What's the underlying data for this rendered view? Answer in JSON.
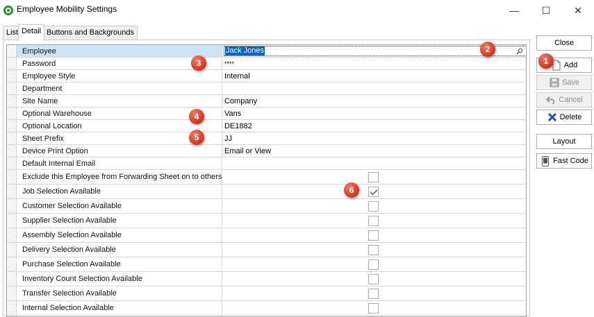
{
  "window": {
    "title": "Employee Mobility Settings",
    "minimize": "—",
    "maximize": "☐",
    "close": "✕"
  },
  "tabs": [
    "List",
    "Detail",
    "Buttons and Backgrounds"
  ],
  "active_tab": "Detail",
  "fields": [
    {
      "label": "Employee",
      "value": "Jack Jones"
    },
    {
      "label": "Password",
      "value": "****"
    },
    {
      "label": "Employee Style",
      "value": "Internal"
    },
    {
      "label": "Department",
      "value": ""
    },
    {
      "label": "Site Name",
      "value": "Company"
    },
    {
      "label": "Optional Warehouse",
      "value": "Vans"
    },
    {
      "label": "Optional Location",
      "value": "DE1882"
    },
    {
      "label": "Sheet Prefix",
      "value": "JJ"
    },
    {
      "label": "Device Print Option",
      "value": "Email or View"
    },
    {
      "label": "Default Internal Email",
      "value": ""
    }
  ],
  "checkboxes": [
    {
      "label": "Exclude this Employee from Forwarding Sheet on to others",
      "checked": false
    },
    {
      "label": "Job Selection Available",
      "checked": true
    },
    {
      "label": "Customer Selection Available",
      "checked": false
    },
    {
      "label": "Supplier Selection Available",
      "checked": false
    },
    {
      "label": "Assembly Selection Available",
      "checked": false
    },
    {
      "label": "Delivery Selection Available",
      "checked": false
    },
    {
      "label": "Purchase Selection Available",
      "checked": false
    },
    {
      "label": "Inventory Count Selection Available",
      "checked": false
    },
    {
      "label": "Transfer Selection Available",
      "checked": false
    },
    {
      "label": "Internal Selection Available",
      "checked": false
    }
  ],
  "buttons": {
    "close": "Close",
    "add": "Add",
    "save": "Save",
    "cancel": "Cancel",
    "delete": "Delete",
    "layout": "Layout",
    "fast_code": "Fast Code"
  },
  "badges": [
    "1",
    "2",
    "3",
    "4",
    "5",
    "6"
  ],
  "colors": {
    "selection": "#0a64c8",
    "selected_row": "#cfe3f7",
    "badge": "#d2321f",
    "delete_icon": "#1d4fb8"
  }
}
